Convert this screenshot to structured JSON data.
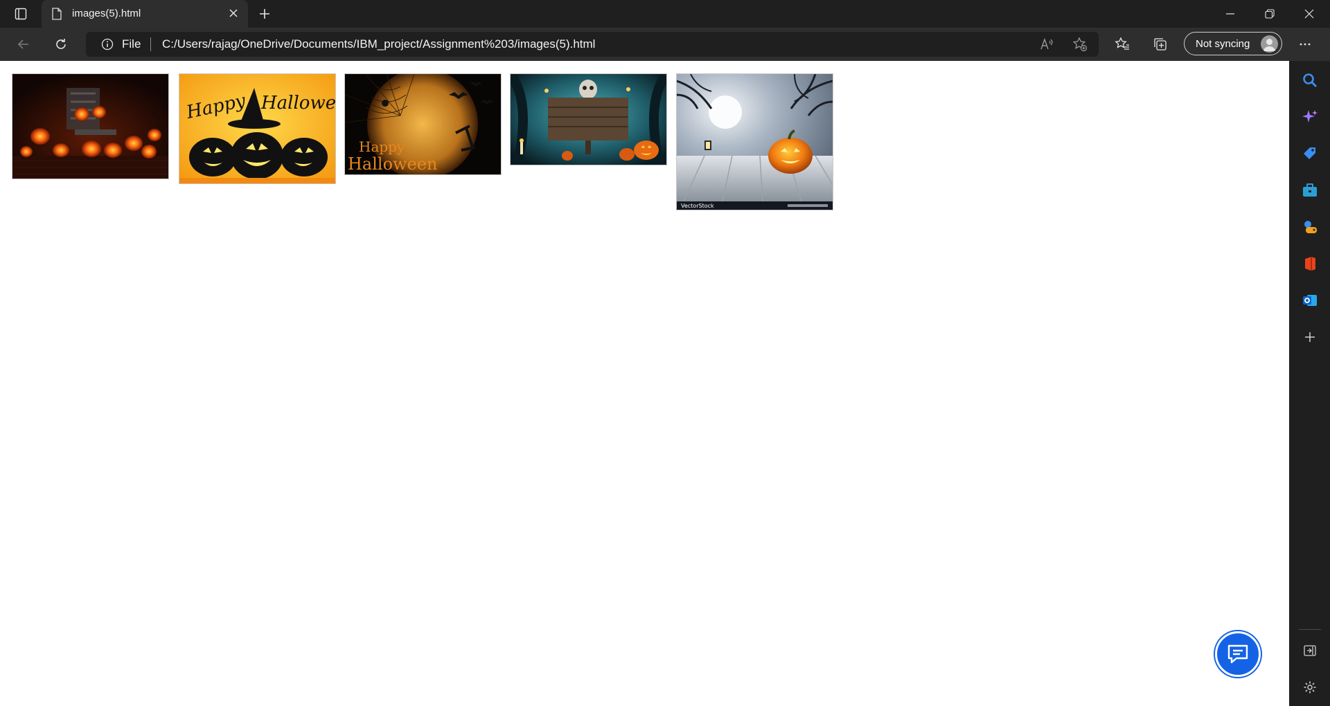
{
  "browser": {
    "tab_title": "images(5).html",
    "address_scheme": "File",
    "address_url": "C:/Users/rajag/OneDrive/Documents/IBM_project/Assignment%203/images(5).html",
    "sync_label": "Not syncing"
  },
  "page": {
    "images": [
      {
        "name": "halloween-image-1",
        "logo_text": ""
      },
      {
        "name": "halloween-image-2",
        "logo_text": "Happy Halloween"
      },
      {
        "name": "halloween-image-3",
        "logo_text": "Happy Halloween"
      },
      {
        "name": "halloween-image-4",
        "logo_text": ""
      },
      {
        "name": "halloween-image-5",
        "logo_text": "VectorStock"
      }
    ]
  },
  "sidebar": {
    "items": [
      "search-icon",
      "copilot-icon",
      "shopping-icon",
      "tools-icon",
      "games-icon",
      "office-icon",
      "outlook-icon",
      "add-icon",
      "hide-sidebar-icon",
      "settings-icon"
    ]
  },
  "colors": {
    "chrome_dark": "#1f1f1f",
    "toolbar": "#2e2e2e",
    "accent": "#1463e6"
  }
}
